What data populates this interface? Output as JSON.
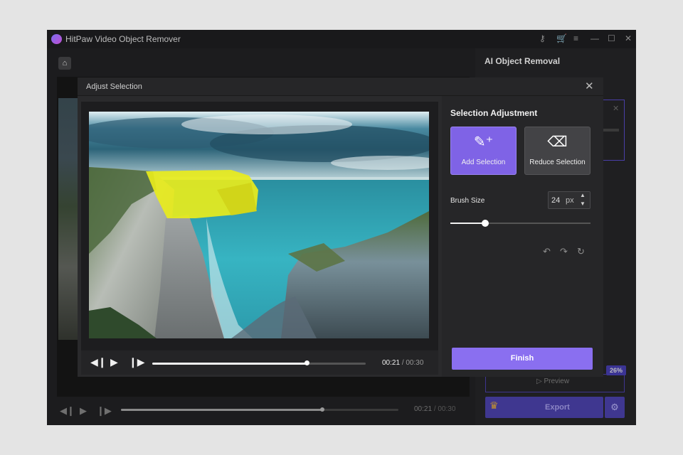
{
  "app": {
    "title": "HitPaw Video Object Remover",
    "titlebar_icons": [
      "key-icon",
      "cart-icon",
      "menu-icon",
      "minimize-icon",
      "maximize-icon",
      "close-icon"
    ],
    "accent": "#7f63e6"
  },
  "background_player": {
    "time_current": "00:21",
    "time_separator": "/",
    "time_total": "00:30",
    "progress": 0.72
  },
  "right_panel": {
    "title": "AI Object Removal",
    "preview_label": "Preview",
    "progress_badge": "26%",
    "export_label": "Export"
  },
  "dialog": {
    "title": "Adjust Selection",
    "player": {
      "time_current": "00:21",
      "time_separator": "/",
      "time_total": "00:30",
      "progress": 0.72
    },
    "sidebar": {
      "title": "Selection Adjustment",
      "add_label": "Add Selection",
      "reduce_label": "Reduce Selection",
      "brush_label": "Brush Size",
      "brush_value": "24",
      "brush_unit": "px",
      "brush_fraction": 0.25,
      "finish_label": "Finish"
    }
  }
}
